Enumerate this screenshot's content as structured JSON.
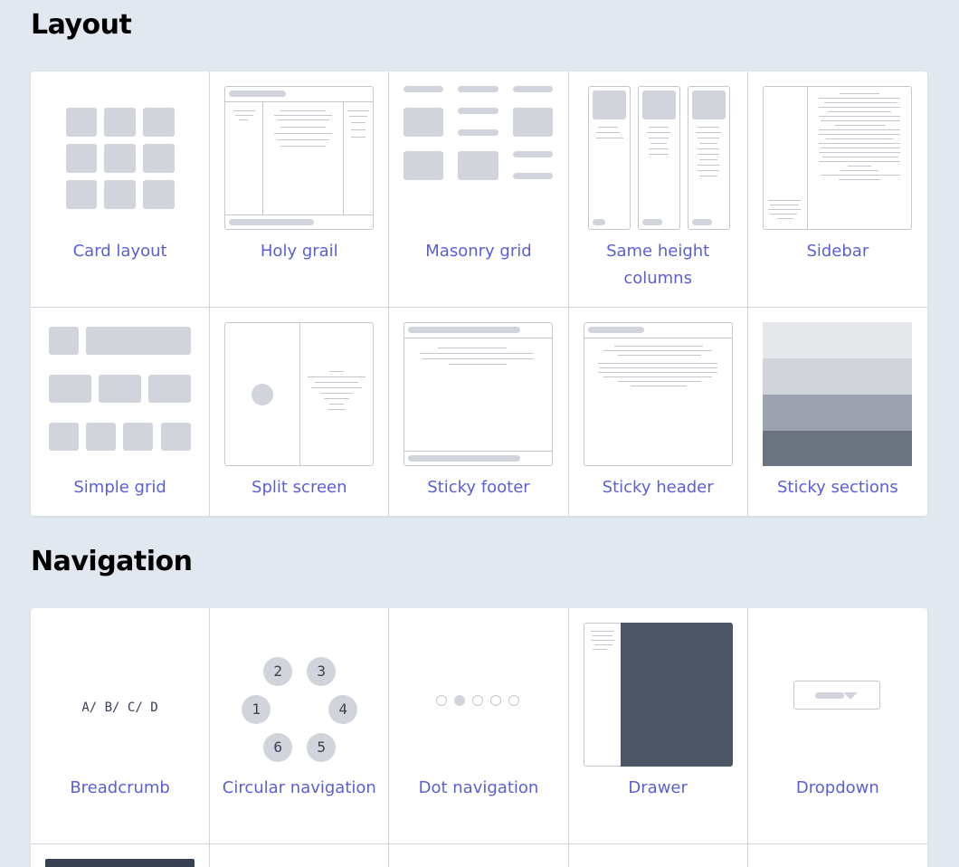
{
  "sections": [
    {
      "title": "Layout",
      "items": [
        "Card layout",
        "Holy grail",
        "Masonry grid",
        "Same height columns",
        "Sidebar",
        "Simple grid",
        "Split screen",
        "Sticky footer",
        "Sticky header",
        "Sticky sections"
      ]
    },
    {
      "title": "Navigation",
      "items": [
        "Breadcrumb",
        "Circular navigation",
        "Dot navigation",
        "Drawer",
        "Dropdown"
      ]
    }
  ],
  "breadcrumb_text": "A/ B/ C/ D",
  "circular_numbers": [
    "1",
    "2",
    "3",
    "4",
    "5",
    "6"
  ],
  "colors": {
    "accent": "#5b5fd6",
    "background": "#e2e8f0",
    "placeholder": "#d1d5db",
    "drawer": "#4b5563"
  }
}
